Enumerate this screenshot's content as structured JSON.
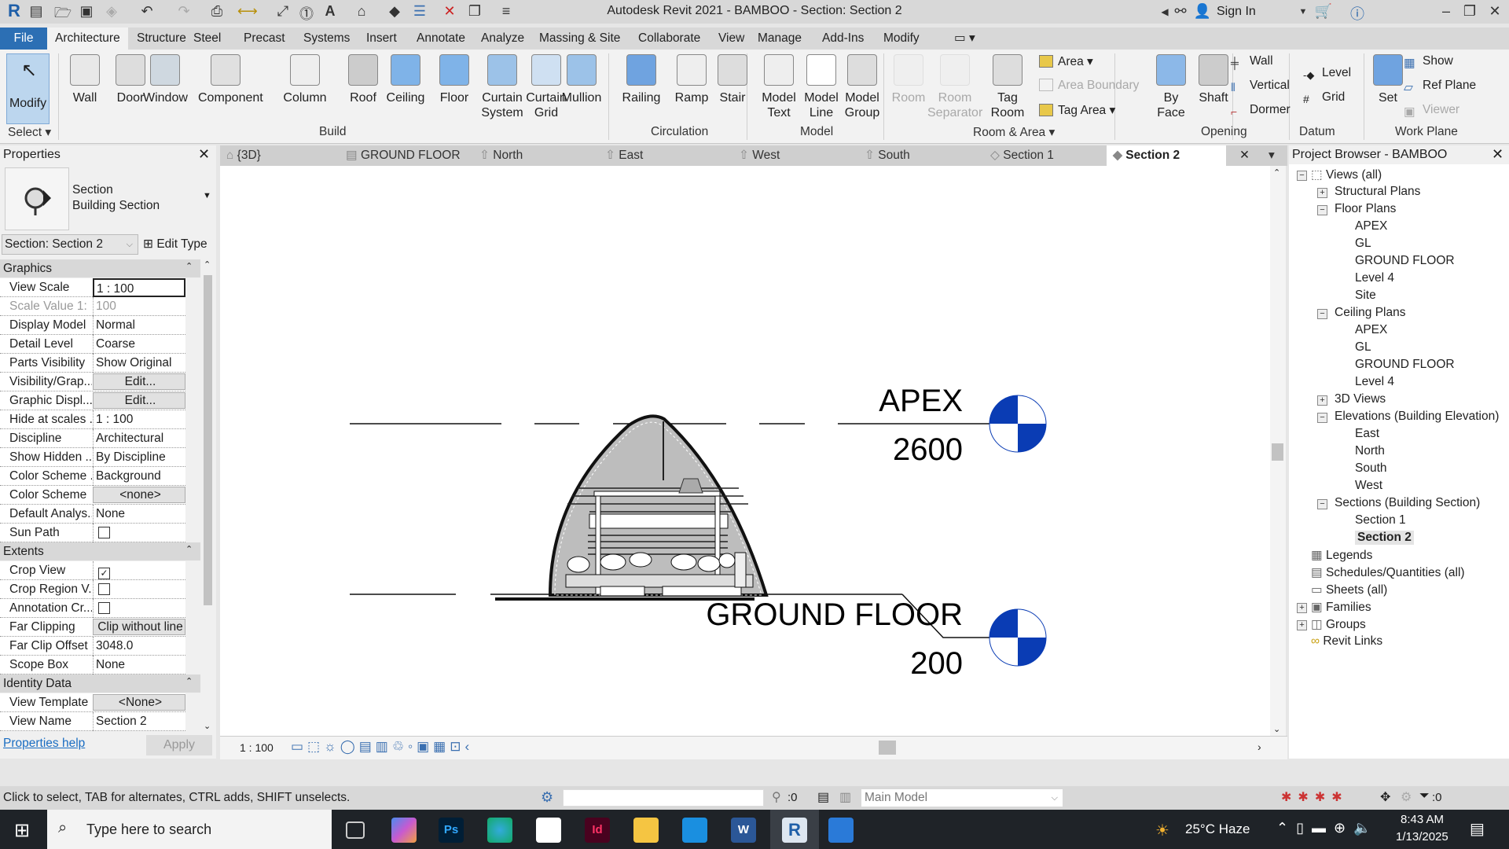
{
  "titlebar": {
    "title": "Autodesk Revit 2021 - BAMBOO - Section: Section 2",
    "sign_in": "Sign In"
  },
  "ribbon_tabs": [
    "File",
    "Architecture",
    "Structure",
    "Steel",
    "Precast",
    "Systems",
    "Insert",
    "Annotate",
    "Analyze",
    "Massing & Site",
    "Collaborate",
    "View",
    "Manage",
    "Add-Ins",
    "Modify"
  ],
  "ribbon": {
    "modify": "Modify",
    "select": "Select",
    "build": {
      "label": "Build",
      "tools": [
        "Wall",
        "Door",
        "Window",
        "Component",
        "Column",
        "Roof",
        "Ceiling",
        "Floor",
        "Curtain System",
        "Curtain Grid",
        "Mullion"
      ]
    },
    "circulation": {
      "label": "Circulation",
      "tools": [
        "Railing",
        "Ramp",
        "Stair"
      ]
    },
    "model": {
      "label": "Model",
      "tools": [
        "Model Text",
        "Model Line",
        "Model Group"
      ]
    },
    "room_area": {
      "label": "Room & Area",
      "tools": [
        "Room",
        "Room Separator",
        "Tag Room"
      ],
      "small": [
        "Area",
        "Area  Boundary",
        "Tag  Area"
      ]
    },
    "opening": {
      "label": "Opening",
      "tools": [
        "By Face",
        "Shaft"
      ],
      "small": [
        "Wall",
        "Vertical",
        "Dormer"
      ]
    },
    "datum": {
      "label": "Datum",
      "small": [
        "Level",
        "Grid"
      ]
    },
    "work_plane": {
      "label": "Work Plane",
      "tools": [
        "Set"
      ],
      "small": [
        "Show",
        "Ref  Plane",
        "Viewer"
      ]
    }
  },
  "properties": {
    "title": "Properties",
    "type_line1": "Section",
    "type_line2": "Building Section",
    "selector": "Section: Section 2",
    "edit_type": "Edit Type",
    "groups": {
      "graphics": "Graphics",
      "extents": "Extents",
      "identity": "Identity Data"
    },
    "graphics_rows": [
      {
        "k": "View Scale",
        "v": "1 : 100"
      },
      {
        "k": "Scale Value    1:",
        "v": "100"
      },
      {
        "k": "Display Model",
        "v": "Normal"
      },
      {
        "k": "Detail Level",
        "v": "Coarse"
      },
      {
        "k": "Parts Visibility",
        "v": "Show Original"
      },
      {
        "k": "Visibility/Grap...",
        "v": "Edit..."
      },
      {
        "k": "Graphic Displ...",
        "v": "Edit..."
      },
      {
        "k": "Hide at scales ...",
        "v": "1 : 100"
      },
      {
        "k": "Discipline",
        "v": "Architectural"
      },
      {
        "k": "Show Hidden ...",
        "v": "By Discipline"
      },
      {
        "k": "Color Scheme ...",
        "v": "Background"
      },
      {
        "k": "Color Scheme",
        "v": "<none>"
      },
      {
        "k": "Default Analys...",
        "v": "None"
      },
      {
        "k": "Sun Path",
        "v": ""
      }
    ],
    "extents_rows": [
      {
        "k": "Crop View",
        "v": "✓"
      },
      {
        "k": "Crop Region V...",
        "v": ""
      },
      {
        "k": "Annotation Cr...",
        "v": ""
      },
      {
        "k": "Far Clipping",
        "v": "Clip without line"
      },
      {
        "k": "Far Clip Offset",
        "v": "3048.0"
      },
      {
        "k": "Scope Box",
        "v": "None"
      }
    ],
    "identity_rows": [
      {
        "k": "View Template",
        "v": "<None>"
      },
      {
        "k": "View Name",
        "v": "Section 2"
      }
    ],
    "help": "Properties help",
    "apply": "Apply"
  },
  "view_tabs": [
    "{3D}",
    "GROUND FLOOR",
    "North",
    "East",
    "West",
    "South",
    "Section 1",
    "Section 2"
  ],
  "drawing": {
    "levels": [
      {
        "name": "APEX",
        "elevation": "2600"
      },
      {
        "name": "GROUND FLOOR",
        "elevation": "200"
      }
    ],
    "level_color": "#0a3cb4"
  },
  "view_bar": {
    "scale": "1 : 100"
  },
  "project_browser": {
    "title": "Project Browser - BAMBOO",
    "tree": [
      {
        "label": "Views (all)",
        "lvl": 0,
        "exp": "-"
      },
      {
        "label": "Structural Plans",
        "lvl": 1,
        "exp": "+"
      },
      {
        "label": "Floor Plans",
        "lvl": 1,
        "exp": "-"
      },
      {
        "label": "APEX",
        "lvl": 2
      },
      {
        "label": "GL",
        "lvl": 2
      },
      {
        "label": "GROUND FLOOR",
        "lvl": 2
      },
      {
        "label": "Level 4",
        "lvl": 2
      },
      {
        "label": "Site",
        "lvl": 2
      },
      {
        "label": "Ceiling Plans",
        "lvl": 1,
        "exp": "-"
      },
      {
        "label": "APEX",
        "lvl": 2
      },
      {
        "label": "GL",
        "lvl": 2
      },
      {
        "label": "GROUND FLOOR",
        "lvl": 2
      },
      {
        "label": "Level 4",
        "lvl": 2
      },
      {
        "label": "3D Views",
        "lvl": 1,
        "exp": "+"
      },
      {
        "label": "Elevations (Building Elevation)",
        "lvl": 1,
        "exp": "-"
      },
      {
        "label": "East",
        "lvl": 2
      },
      {
        "label": "North",
        "lvl": 2
      },
      {
        "label": "South",
        "lvl": 2
      },
      {
        "label": "West",
        "lvl": 2
      },
      {
        "label": "Sections (Building Section)",
        "lvl": 1,
        "exp": "-"
      },
      {
        "label": "Section 1",
        "lvl": 2
      },
      {
        "label": "Section 2",
        "lvl": 2,
        "selected": true
      },
      {
        "label": "Legends",
        "lvl": 0
      },
      {
        "label": "Schedules/Quantities (all)",
        "lvl": 0
      },
      {
        "label": "Sheets (all)",
        "lvl": 0
      },
      {
        "label": "Families",
        "lvl": 0,
        "exp": "+"
      },
      {
        "label": "Groups",
        "lvl": 0,
        "exp": "+"
      },
      {
        "label": "Revit Links",
        "lvl": 0
      }
    ]
  },
  "status": {
    "hint": "Click to select, TAB for alternates, CTRL adds, SHIFT unselects.",
    "count1": ":0",
    "workset": "Main Model",
    "filter_count": ":0"
  },
  "taskbar": {
    "search_placeholder": "Type here to search",
    "weather": "25°C  Haze",
    "time": "8:43 AM",
    "date": "1/13/2025"
  }
}
